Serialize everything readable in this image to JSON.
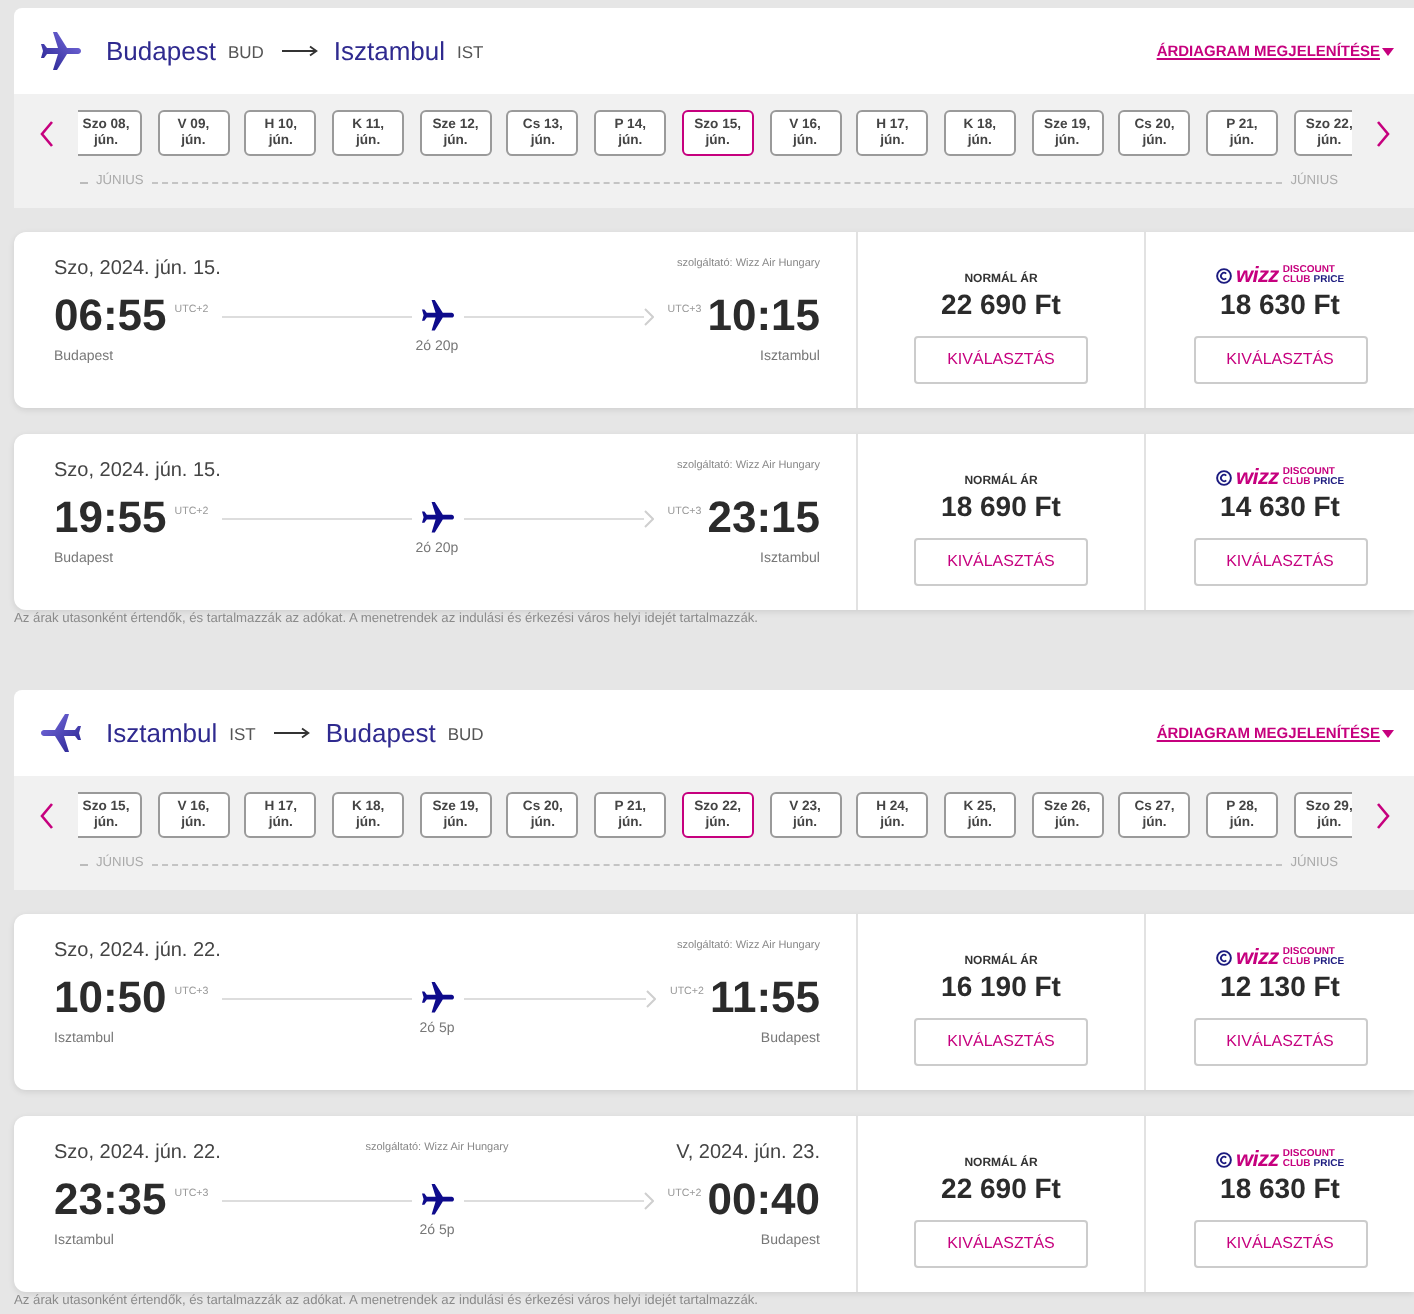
{
  "sections": [
    {
      "kind": "outbound",
      "route": {
        "from_city": "Budapest",
        "from_code": "BUD",
        "to_city": "Isztambul",
        "to_code": "IST"
      },
      "price_chart_link": "ÁRDIAGRAM MEGJELENÍTÉSE",
      "dates": [
        {
          "day": "Szo 08,",
          "month": "jún.",
          "selected": false
        },
        {
          "day": "V 09,",
          "month": "jún.",
          "selected": false
        },
        {
          "day": "H 10,",
          "month": "jún.",
          "selected": false
        },
        {
          "day": "K 11,",
          "month": "jún.",
          "selected": false
        },
        {
          "day": "Sze 12,",
          "month": "jún.",
          "selected": false
        },
        {
          "day": "Cs 13,",
          "month": "jún.",
          "selected": false
        },
        {
          "day": "P 14,",
          "month": "jún.",
          "selected": false
        },
        {
          "day": "Szo 15,",
          "month": "jún.",
          "selected": true
        },
        {
          "day": "V 16,",
          "month": "jún.",
          "selected": false
        },
        {
          "day": "H 17,",
          "month": "jún.",
          "selected": false
        },
        {
          "day": "K 18,",
          "month": "jún.",
          "selected": false
        },
        {
          "day": "Sze 19,",
          "month": "jún.",
          "selected": false
        },
        {
          "day": "Cs 20,",
          "month": "jún.",
          "selected": false
        },
        {
          "day": "P 21,",
          "month": "jún.",
          "selected": false
        },
        {
          "day": "Szo 22,",
          "month": "jún.",
          "selected": false
        }
      ],
      "month_labels": [
        "JÚNIUS",
        "JÚNIUS"
      ],
      "flights": [
        {
          "departure_date": "Szo, 2024. jún. 15.",
          "operator": "szolgáltató: Wizz Air Hungary",
          "departure_time": "06:55",
          "departure_utc": "UTC+2",
          "arrival_utc": "UTC+3",
          "arrival_time": "10:15",
          "departure_city": "Budapest",
          "duration": "2ó 20p",
          "arrival_city": "Isztambul",
          "fares": [
            {
              "kind": "normal",
              "label": "NORMÁL ÁR",
              "price": "22 690 Ft",
              "button": "KIVÁLASZTÁS"
            },
            {
              "kind": "club",
              "logo": {
                "wordmark": "wizz",
                "line_1": "DISCOUNT",
                "line_2": "CLUB",
                "line_3": "PRICE"
              },
              "price": "18 630 Ft",
              "button": "KIVÁLASZTÁS"
            }
          ]
        },
        {
          "departure_date": "Szo, 2024. jún. 15.",
          "operator": "szolgáltató: Wizz Air Hungary",
          "departure_time": "19:55",
          "departure_utc": "UTC+2",
          "arrival_utc": "UTC+3",
          "arrival_time": "23:15",
          "departure_city": "Budapest",
          "duration": "2ó 20p",
          "arrival_city": "Isztambul",
          "fares": [
            {
              "kind": "normal",
              "label": "NORMÁL ÁR",
              "price": "18 690 Ft",
              "button": "KIVÁLASZTÁS"
            },
            {
              "kind": "club",
              "logo": {
                "wordmark": "wizz",
                "line_1": "DISCOUNT",
                "line_2": "CLUB",
                "line_3": "PRICE"
              },
              "price": "14 630 Ft",
              "button": "KIVÁLASZTÁS"
            }
          ]
        }
      ],
      "footnote": "Az árak utasonként értendők, és tartalmazzák az adókat. A menetrendek az indulási és érkezési város helyi idejét tartalmazzák."
    },
    {
      "kind": "return",
      "route": {
        "from_city": "Isztambul",
        "from_code": "IST",
        "to_city": "Budapest",
        "to_code": "BUD"
      },
      "price_chart_link": "ÁRDIAGRAM MEGJELENÍTÉSE",
      "dates": [
        {
          "day": "Szo 15,",
          "month": "jún.",
          "selected": false
        },
        {
          "day": "V 16,",
          "month": "jún.",
          "selected": false
        },
        {
          "day": "H 17,",
          "month": "jún.",
          "selected": false
        },
        {
          "day": "K 18,",
          "month": "jún.",
          "selected": false
        },
        {
          "day": "Sze 19,",
          "month": "jún.",
          "selected": false
        },
        {
          "day": "Cs 20,",
          "month": "jún.",
          "selected": false
        },
        {
          "day": "P 21,",
          "month": "jún.",
          "selected": false
        },
        {
          "day": "Szo 22,",
          "month": "jún.",
          "selected": true
        },
        {
          "day": "V 23,",
          "month": "jún.",
          "selected": false
        },
        {
          "day": "H 24,",
          "month": "jún.",
          "selected": false
        },
        {
          "day": "K 25,",
          "month": "jún.",
          "selected": false
        },
        {
          "day": "Sze 26,",
          "month": "jún.",
          "selected": false
        },
        {
          "day": "Cs 27,",
          "month": "jún.",
          "selected": false
        },
        {
          "day": "P 28,",
          "month": "jún.",
          "selected": false
        },
        {
          "day": "Szo 29,",
          "month": "jún.",
          "selected": false
        }
      ],
      "month_labels": [
        "JÚNIUS",
        "JÚNIUS"
      ],
      "flights": [
        {
          "departure_date": "Szo, 2024. jún. 22.",
          "operator": "szolgáltató: Wizz Air Hungary",
          "departure_time": "10:50",
          "departure_utc": "UTC+3",
          "arrival_utc": "UTC+2",
          "arrival_time": "11:55",
          "departure_city": "Isztambul",
          "duration": "2ó 5p",
          "arrival_city": "Budapest",
          "fares": [
            {
              "kind": "normal",
              "label": "NORMÁL ÁR",
              "price": "16 190 Ft",
              "button": "KIVÁLASZTÁS"
            },
            {
              "kind": "club",
              "logo": {
                "wordmark": "wizz",
                "line_1": "DISCOUNT",
                "line_2": "CLUB",
                "line_3": "PRICE"
              },
              "price": "12 130 Ft",
              "button": "KIVÁLASZTÁS"
            }
          ]
        },
        {
          "departure_date": "Szo, 2024. jún. 22.",
          "operator": "szolgáltató: Wizz Air Hungary",
          "arrival_date": "V, 2024. jún. 23.",
          "departure_time": "23:35",
          "departure_utc": "UTC+3",
          "arrival_utc": "UTC+2",
          "arrival_time": "00:40",
          "departure_city": "Isztambul",
          "duration": "2ó 5p",
          "arrival_city": "Budapest",
          "fares": [
            {
              "kind": "normal",
              "label": "NORMÁL ÁR",
              "price": "22 690 Ft",
              "button": "KIVÁLASZTÁS"
            },
            {
              "kind": "club",
              "logo": {
                "wordmark": "wizz",
                "line_1": "DISCOUNT",
                "line_2": "CLUB",
                "line_3": "PRICE"
              },
              "price": "18 630 Ft",
              "button": "KIVÁLASZTÁS"
            }
          ]
        }
      ],
      "footnote": "Az árak utasonként értendők, és tartalmazzák az adókat. A menetrendek az indulási és érkezési város helyi idejét tartalmazzák."
    }
  ]
}
